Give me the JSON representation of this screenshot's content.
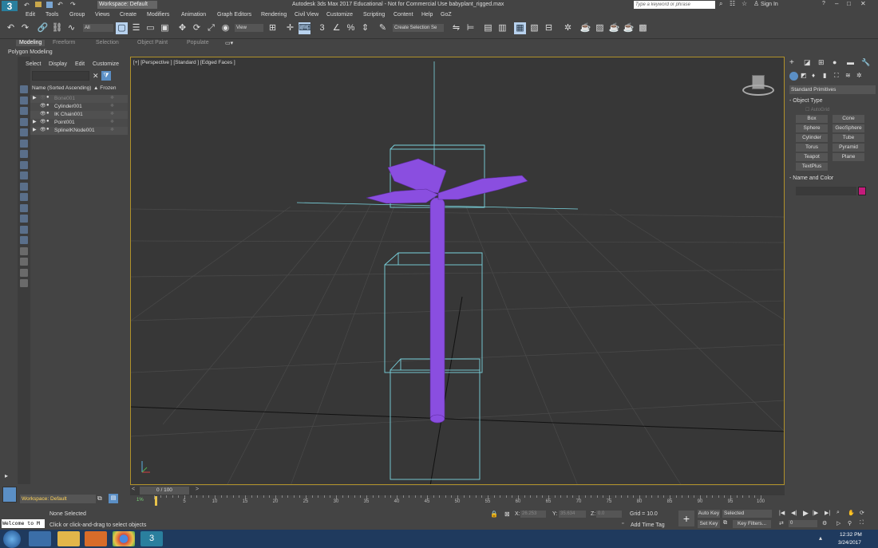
{
  "titlebar": {
    "app_label": "MAX",
    "workspace": "Workspace: Default",
    "title": "Autodesk 3ds Max 2017 Educational - Not for Commercial Use    babyplant_rigged.max",
    "search_placeholder": "Type a keyword or phrase",
    "signin": "Sign In"
  },
  "menu": [
    "Edit",
    "Tools",
    "Group",
    "Views",
    "Create",
    "Modifiers",
    "Animation",
    "Graph Editors",
    "Rendering",
    "Civil View",
    "Customize",
    "Scripting",
    "Content",
    "Help",
    "GoZ"
  ],
  "toolbar": {
    "filter_value": "All",
    "view_value": "View",
    "selection_set_placeholder": "Create Selection Se"
  },
  "ribbon": {
    "tabs": [
      "Modeling",
      "Freeform",
      "Selection",
      "Object Paint",
      "Populate"
    ],
    "sub": "Polygon Modeling"
  },
  "scene_explorer": {
    "menu": [
      "Select",
      "Display",
      "Edit",
      "Customize"
    ],
    "col_name": "Name (Sorted Ascending)",
    "col_frozen": "▲ Frozen",
    "items": [
      {
        "name": "Bone001",
        "dim": true
      },
      {
        "name": "Cylinder001",
        "dim": false
      },
      {
        "name": "IK Chain001",
        "dim": false
      },
      {
        "name": "Point001",
        "dim": false
      },
      {
        "name": "SplineIKNode001",
        "dim": false
      }
    ]
  },
  "viewport": {
    "label": "[+] [Perspective ] [Standard ] [Edged Faces ]"
  },
  "command_panel": {
    "category": "Standard Primitives",
    "object_type_title": "Object Type",
    "autogrid": "AutoGrid",
    "buttons": [
      "Box",
      "Cone",
      "Sphere",
      "GeoSphere",
      "Cylinder",
      "Tube",
      "Torus",
      "Pyramid",
      "Teapot",
      "Plane",
      "TextPlus"
    ],
    "name_color_title": "Name and Color",
    "swatch_color": "#c41b7b"
  },
  "timeline": {
    "slider_label": "0 / 100",
    "ticks": [
      "5",
      "10",
      "15",
      "20",
      "25",
      "30",
      "35",
      "40",
      "45",
      "50",
      "55",
      "60",
      "65",
      "70",
      "75",
      "80",
      "85",
      "90",
      "95",
      "100"
    ]
  },
  "status": {
    "workspace": "Workspace: Default",
    "maxscript": "Welcome to M",
    "selection": "None Selected",
    "prompt": "Click or click-and-drag to select objects",
    "x_label": "X:",
    "x_value": "26.253",
    "y_label": "Y:",
    "y_value": "35.634",
    "z_label": "Z:",
    "z_value": "0.0",
    "grid": "Grid = 10.0",
    "add_time_tag": "Add Time Tag",
    "auto_key": "Auto Key",
    "key_mode": "Selected",
    "set_key": "Set Key",
    "key_filters": "Key Filters...",
    "frame": "0"
  },
  "taskbar": {
    "time": "12:32 PM",
    "date": "3/24/2017"
  },
  "colors": {
    "plant": "#7b3fd6",
    "bbox": "#7ad3de",
    "accent": "#b0912a"
  }
}
